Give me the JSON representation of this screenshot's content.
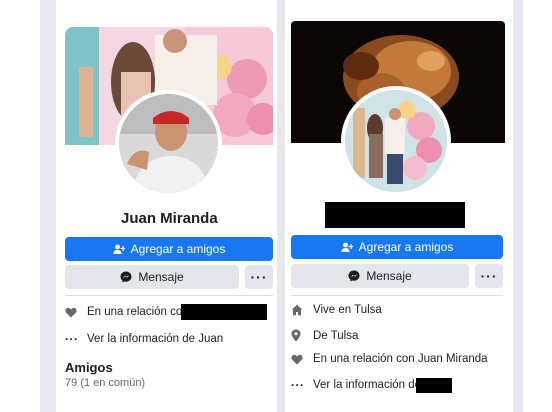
{
  "left_profile": {
    "name": "Juan Miranda",
    "add_friend_label": "Agregar a amigos",
    "message_label": "Mensaje",
    "more_label": "···",
    "relationship_prefix": "En una relación con",
    "see_info_label": "Ver la información de Juan",
    "friends_title": "Amigos",
    "friends_count": "79 (1 en común)"
  },
  "right_profile": {
    "add_friend_label": "Agregar a amigos",
    "message_label": "Mensaje",
    "more_label": "···",
    "lives_in": "Vive en Tulsa",
    "from": "De Tulsa",
    "relationship": "En una relación con Juan Miranda",
    "see_info_prefix": "Ver la información de"
  },
  "colors": {
    "primary_button": "#1877f2",
    "secondary_button": "#e4e6eb",
    "icon_gray": "#65676b"
  },
  "icons": [
    "add-friend-icon",
    "messenger-icon",
    "heart-icon",
    "house-icon",
    "location-pin-icon",
    "ellipsis-icon"
  ]
}
